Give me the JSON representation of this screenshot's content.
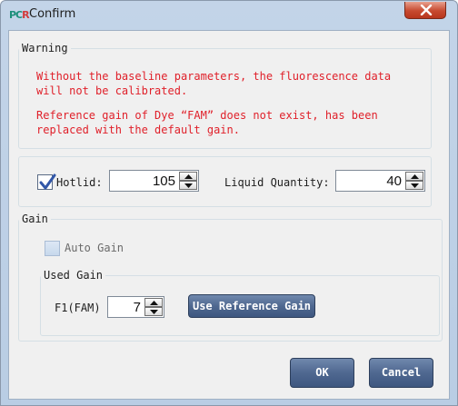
{
  "window": {
    "icon_text_a": "PC",
    "icon_text_b": "R",
    "title": "Confirm",
    "close_icon": "close-x-icon"
  },
  "warning": {
    "legend": "Warning",
    "line1": "Without the baseline parameters, the fluorescence data",
    "line2": "will not be calibrated.",
    "line3": "Reference gain of Dye “FAM” does not exist, has been",
    "line4": "replaced with the default gain."
  },
  "settings": {
    "hotlid_checked": true,
    "hotlid_label": "Hotlid:",
    "hotlid_value": "105",
    "liquid_label": "Liquid Quantity:",
    "liquid_value": "40"
  },
  "gain": {
    "legend": "Gain",
    "auto_gain_label": "Auto Gain",
    "auto_gain_checked": false,
    "used_gain_legend": "Used Gain",
    "channel_label": "F1(FAM)",
    "channel_value": "7",
    "reference_button": "Use Reference Gain"
  },
  "buttons": {
    "ok": "OK",
    "cancel": "Cancel"
  },
  "colors": {
    "warning_text": "#e0202a",
    "button_blue": "#4f6890",
    "close_red": "#c74a30"
  }
}
